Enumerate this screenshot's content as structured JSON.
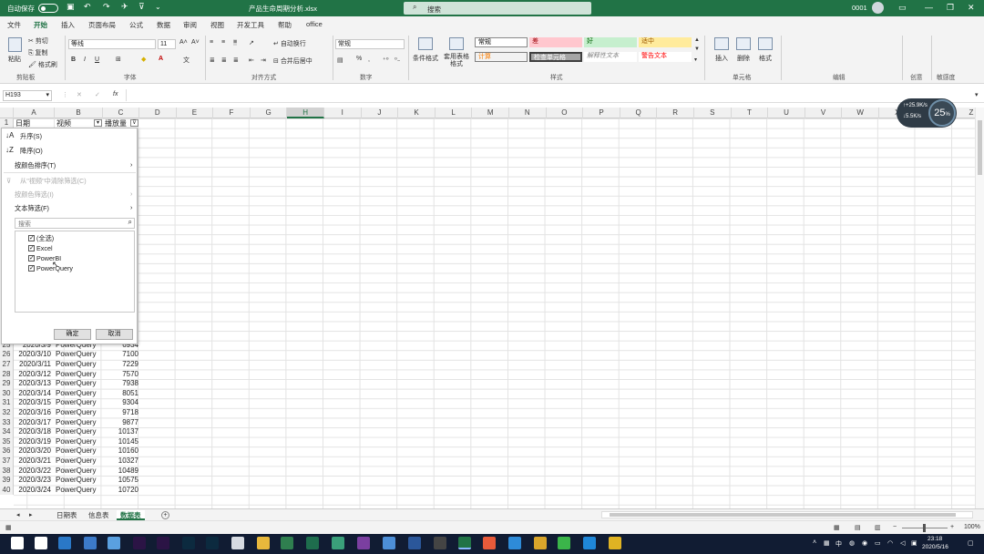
{
  "titlebar": {
    "autosave": "自动保存",
    "filename": "产品生命周期分析.xlsx",
    "search": "搜索",
    "user": "0001"
  },
  "tabs": [
    "文件",
    "开始",
    "插入",
    "页面布局",
    "公式",
    "数据",
    "审阅",
    "视图",
    "开发工具",
    "帮助",
    "office"
  ],
  "ribbon": {
    "clipboard": {
      "paste": "粘贴",
      "cut": "剪切",
      "copy": "复制",
      "painter": "格式刷",
      "group": "剪贴板"
    },
    "font": {
      "name": "等线",
      "size": "11",
      "group": "字体",
      "bold": "B",
      "italic": "I",
      "underline": "U"
    },
    "alignment": {
      "wrap": "自动换行",
      "merge": "合并后居中",
      "group": "对齐方式"
    },
    "number": {
      "format": "常规",
      "percent": "%",
      "group": "数字"
    },
    "styles": {
      "conditional": "条件格式",
      "table_fmt": "套用表格格式",
      "group": "样式",
      "cells": [
        {
          "label": "常规",
          "bg": "#ffffff",
          "fg": "#000000"
        },
        {
          "label": "差",
          "bg": "#ffc7ce",
          "fg": "#9c0006"
        },
        {
          "label": "好",
          "bg": "#c6efce",
          "fg": "#006100"
        },
        {
          "label": "适中",
          "bg": "#ffeb9c",
          "fg": "#9c5700"
        },
        {
          "label": "计算",
          "bg": "#f2f2f2",
          "fg": "#fa7d00"
        },
        {
          "label": "检查单元格",
          "bg": "#a5a5a5",
          "fg": "#ffffff"
        },
        {
          "label": "解释性文本",
          "bg": "#ffffff",
          "fg": "#7f7f7f"
        },
        {
          "label": "警告文本",
          "bg": "#ffffff",
          "fg": "#ff0000"
        }
      ]
    },
    "cells_grp": {
      "insert": "插入",
      "delete": "删除",
      "format": "格式",
      "group": "单元格"
    },
    "edit_group": "编辑",
    "idea_group": "创意",
    "sensitivity_group": "敏感度"
  },
  "formula": {
    "namebox": "H193",
    "fx": "fx"
  },
  "columns": [
    "A",
    "B",
    "C",
    "D",
    "E",
    "F",
    "G",
    "H",
    "I",
    "J",
    "K",
    "L",
    "M",
    "N",
    "O",
    "P",
    "Q",
    "R",
    "S",
    "T",
    "U",
    "V",
    "W",
    "X",
    "Y",
    "Z"
  ],
  "header_row": {
    "num": "1",
    "a": "日期",
    "b": "视频",
    "c": "播放量"
  },
  "rows": [
    {
      "num": "25",
      "date": "2020/3/9",
      "video": "PowerQuery",
      "plays": "6934"
    },
    {
      "num": "26",
      "date": "2020/3/10",
      "video": "PowerQuery",
      "plays": "7100"
    },
    {
      "num": "27",
      "date": "2020/3/11",
      "video": "PowerQuery",
      "plays": "7229"
    },
    {
      "num": "28",
      "date": "2020/3/12",
      "video": "PowerQuery",
      "plays": "7570"
    },
    {
      "num": "29",
      "date": "2020/3/13",
      "video": "PowerQuery",
      "plays": "7938"
    },
    {
      "num": "30",
      "date": "2020/3/14",
      "video": "PowerQuery",
      "plays": "8051"
    },
    {
      "num": "31",
      "date": "2020/3/15",
      "video": "PowerQuery",
      "plays": "9304"
    },
    {
      "num": "32",
      "date": "2020/3/16",
      "video": "PowerQuery",
      "plays": "9718"
    },
    {
      "num": "33",
      "date": "2020/3/17",
      "video": "PowerQuery",
      "plays": "9877"
    },
    {
      "num": "34",
      "date": "2020/3/18",
      "video": "PowerQuery",
      "plays": "10137"
    },
    {
      "num": "35",
      "date": "2020/3/19",
      "video": "PowerQuery",
      "plays": "10145"
    },
    {
      "num": "36",
      "date": "2020/3/20",
      "video": "PowerQuery",
      "plays": "10160"
    },
    {
      "num": "37",
      "date": "2020/3/21",
      "video": "PowerQuery",
      "plays": "10327"
    },
    {
      "num": "38",
      "date": "2020/3/22",
      "video": "PowerQuery",
      "plays": "10489"
    },
    {
      "num": "39",
      "date": "2020/3/23",
      "video": "PowerQuery",
      "plays": "10575"
    },
    {
      "num": "40",
      "date": "2020/3/24",
      "video": "PowerQuery",
      "plays": "10720"
    }
  ],
  "filter": {
    "sort_asc": "升序(S)",
    "sort_desc": "降序(O)",
    "sort_color": "按颜色排序(T)",
    "clear": "从\"视频\"中清除筛选(C)",
    "filter_color": "按颜色筛选(I)",
    "text_filter": "文本筛选(F)",
    "search_placeholder": "搜索",
    "items": [
      "(全选)",
      "Excel",
      "PowerBI",
      "PowerQuery"
    ],
    "ok": "确定",
    "cancel": "取消"
  },
  "sheets": [
    "日期表",
    "信息表",
    "数据表"
  ],
  "active_sheet": "数据表",
  "status": {
    "zoom": "100%"
  },
  "perf": {
    "up": "+25.9",
    "up_unit": "K/s",
    "down": "5.5",
    "down_unit": "K/s",
    "pct": "25",
    "pct_unit": "%"
  },
  "clock": {
    "time": "23:18",
    "date": "2020/5/16"
  },
  "tray": {
    "lang": "中"
  },
  "accent": "#217346"
}
